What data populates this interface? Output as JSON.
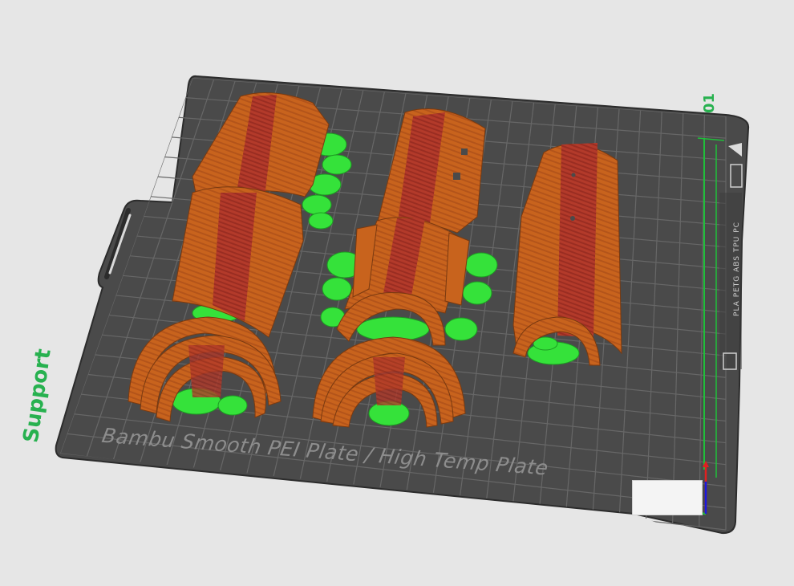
{
  "viewport": {
    "plate_label": "Bambu Smooth PEI Plate / High Temp Plate",
    "plate_number": "01",
    "feature_label": "Support",
    "plate_filament_text": "PLA PETG ABS TPU PC"
  },
  "parts": [
    {
      "name": "left-cylinder-part"
    },
    {
      "name": "middle-cylinder-part"
    },
    {
      "name": "right-cylinder-part"
    }
  ],
  "colors": {
    "background": "#e6e6e6",
    "plate": "#4a4a4a",
    "grid": "#6a6a6a",
    "wall_orange": "#c8631d",
    "infill_red": "#b33a2a",
    "support_green": "#35e23a",
    "axis_green": "#1fbf3a",
    "axis_red": "#e02020",
    "axis_blue": "#1a1ae0"
  },
  "icons": [
    "orientation-cube-icon",
    "plate-logo-icon"
  ]
}
